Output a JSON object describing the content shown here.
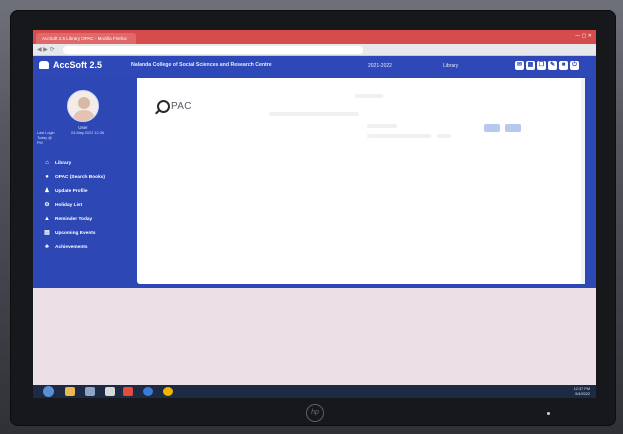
{
  "browser": {
    "tab_title": "AccSoft 2.5 Library OPAC - Mozilla Firefox",
    "window_controls": "— ▢ ✕"
  },
  "app": {
    "brand": "AccSoft 2.5",
    "college": "Nalanda College of Social Sciences and Research Centre",
    "year": "2021-2022",
    "section": "Library"
  },
  "user": {
    "name": "User",
    "last_login_label": "Last Login\nToday @\nPM",
    "last_login_value": "04-May-2022 12:36"
  },
  "menu": [
    {
      "label": "Library",
      "icon": "library-icon"
    },
    {
      "label": "OPAC (Search Books)",
      "icon": "search-icon"
    },
    {
      "label": "Update Profile",
      "icon": "user-icon"
    },
    {
      "label": "Holiday List",
      "icon": "calendar-icon"
    },
    {
      "label": "Reminder Today",
      "icon": "bell-icon"
    },
    {
      "label": "Upcoming Events",
      "icon": "event-icon"
    },
    {
      "label": "Achievements",
      "icon": "trophy-icon"
    }
  ],
  "main": {
    "logo_text": "PAC"
  },
  "taskbar": {
    "clock": "12:37 PM\n5/4/2022"
  },
  "colors": {
    "header": "#2f48b8",
    "sidebar": "#2d47b5",
    "browser_tab": "#d64b4b"
  }
}
